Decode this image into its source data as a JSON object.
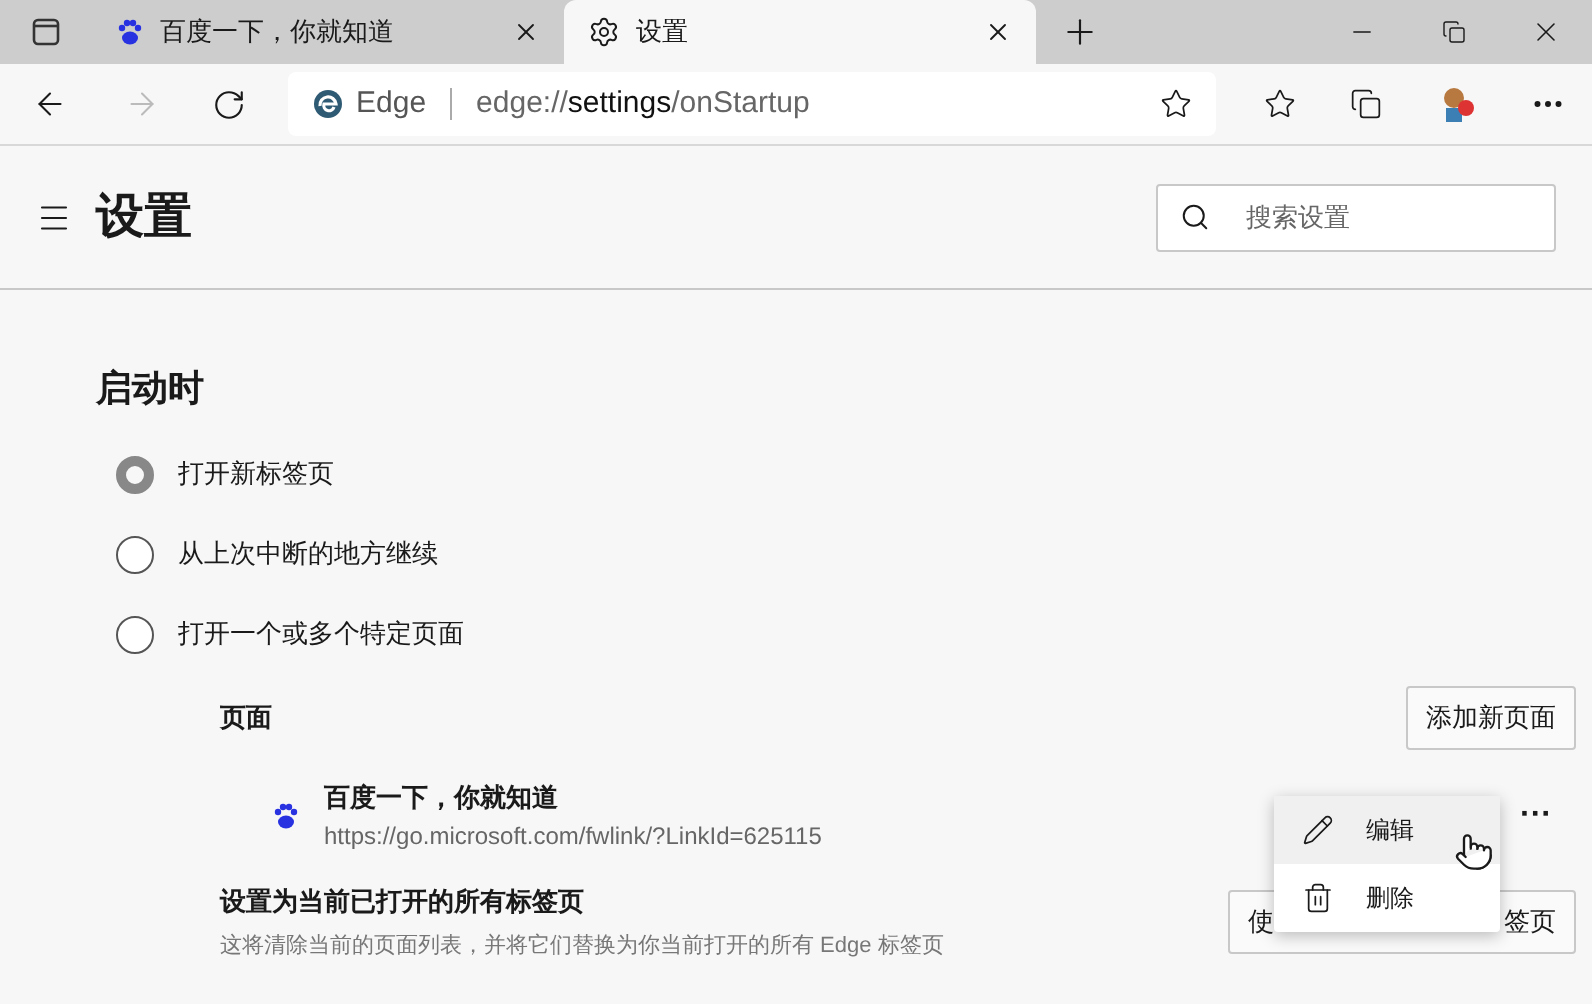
{
  "tabs": [
    {
      "title": "百度一下，你就知道",
      "kind": "web",
      "selected": false
    },
    {
      "title": "设置",
      "kind": "settings",
      "selected": true
    }
  ],
  "address": {
    "badge": "Edge",
    "url_prefix": "edge://",
    "url_bold": "settings",
    "url_rest": "/onStartup"
  },
  "header": {
    "title": "设置",
    "search": {
      "placeholder": "搜索设置"
    }
  },
  "section": {
    "title": "启动时",
    "options": [
      {
        "label": "打开新标签页",
        "selected": true
      },
      {
        "label": "从上次中断的地方继续",
        "selected": false
      },
      {
        "label": "打开一个或多个特定页面",
        "selected": false
      }
    ],
    "pages": {
      "label": "页面",
      "add_button": "添加新页面",
      "items": [
        {
          "title": "百度一下，你就知道",
          "url": "https://go.microsoft.com/fwlink/?LinkId=625115",
          "more": "···"
        }
      ]
    },
    "menu": [
      {
        "kind": "edit",
        "label": "编辑",
        "selected": true
      },
      {
        "kind": "delete",
        "label": "删除",
        "selected": false
      }
    ],
    "set_current": {
      "title": "设置为当前已打开的所有标签页",
      "description": "这将清除当前的页面列表，并将它们替换为你当前打开的所有 Edge 标签页",
      "button_start": "使",
      "button_end": "签页"
    }
  }
}
